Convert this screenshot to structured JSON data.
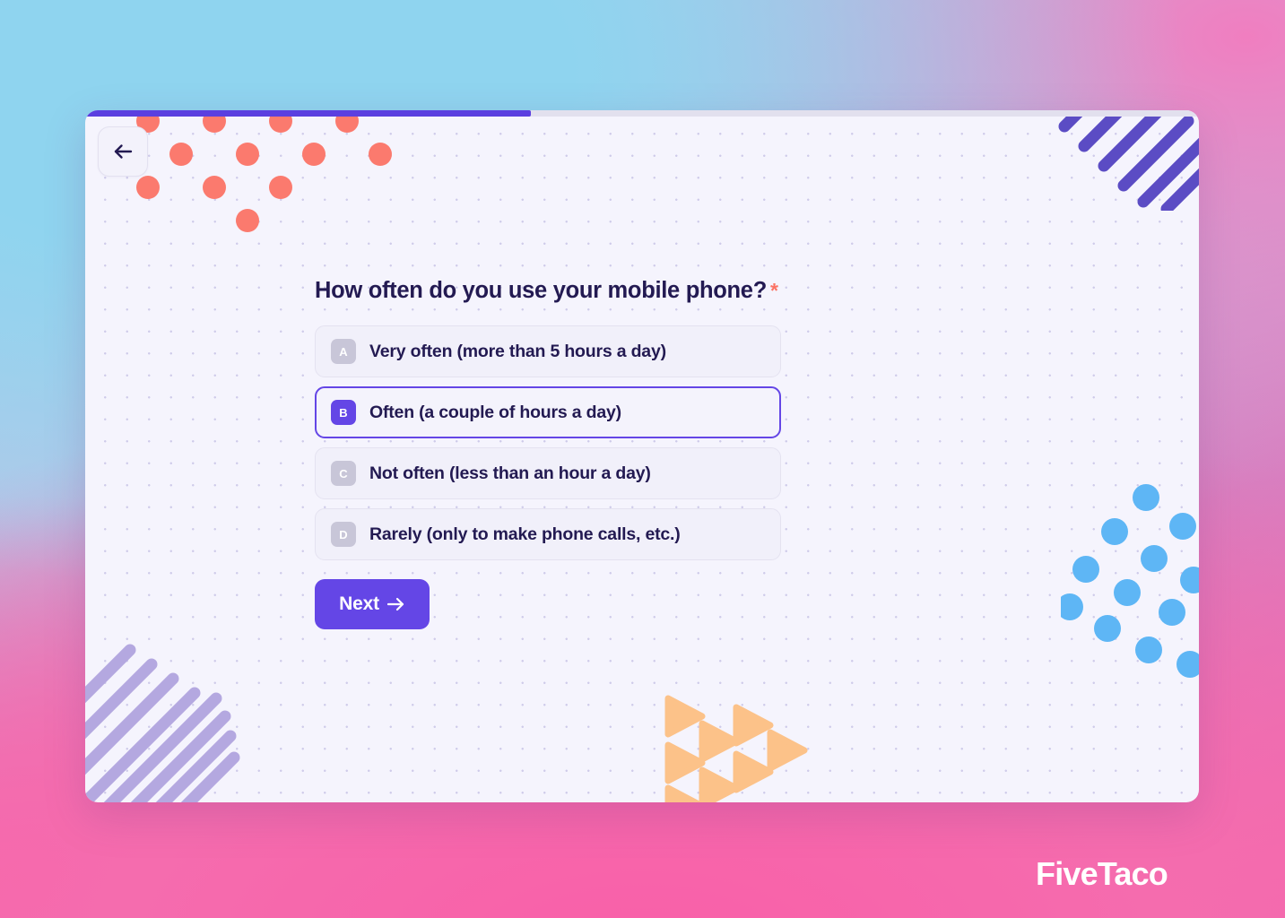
{
  "page": {
    "background_gradient": [
      "#8fd4ef",
      "#b6c6e8",
      "#e07cbe",
      "#f95fa8"
    ],
    "watermark": "FiveTaco"
  },
  "card": {
    "background": "#f5f4fd",
    "progress": {
      "percent": 40,
      "fill_color": "#5b3fe0",
      "track_color": "#e2e0ee"
    },
    "back_button": {
      "icon": "arrow-left-icon",
      "label": ""
    }
  },
  "form": {
    "question": "How often do you use your mobile phone?",
    "required_marker": "*",
    "required_marker_color": "#fb7365",
    "selected_option": "B",
    "accent_color": "#6446e6",
    "options": [
      {
        "key": "A",
        "label": "Very often (more than 5 hours a day)",
        "selected": false
      },
      {
        "key": "B",
        "label": "Often (a couple of hours a day)",
        "selected": true
      },
      {
        "key": "C",
        "label": "Not often (less than an hour a day)",
        "selected": false
      },
      {
        "key": "D",
        "label": "Rarely (only to make phone calls, etc.)",
        "selected": false
      }
    ],
    "next_button": {
      "label": "Next",
      "icon": "arrow-right-icon"
    }
  },
  "decorations": {
    "coral_dots": {
      "color": "#fb7a6e",
      "shape": "triangle-grid-of-circles"
    },
    "purple_stripes_top_right": {
      "color": "#5b4cc4",
      "shape": "diagonal-stripes"
    },
    "lavender_stripes_bottom_left": {
      "color": "#b4a8e0",
      "shape": "diagonal-stripes"
    },
    "blue_dots": {
      "color": "#5eb6f5",
      "shape": "diagonal-dot-grid"
    },
    "orange_triangles": {
      "color": "#fcc289",
      "shape": "triangle-grid"
    }
  }
}
